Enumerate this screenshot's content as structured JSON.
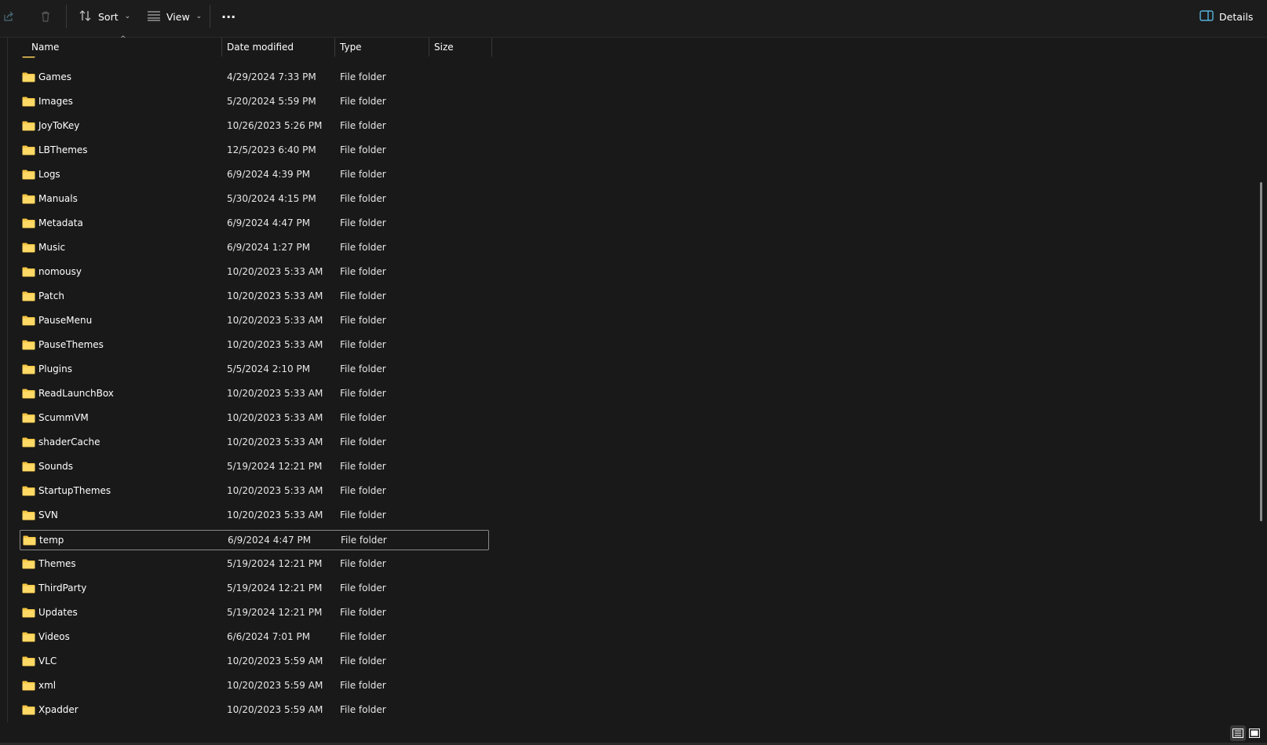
{
  "toolbar": {
    "sort_label": "Sort",
    "view_label": "View",
    "more_label": "···",
    "details_label": "Details"
  },
  "columns": {
    "name": "Name",
    "date": "Date modified",
    "type": "Type",
    "size": "Size"
  },
  "files": [
    {
      "name": "Games",
      "date": "4/29/2024 7:33 PM",
      "type": "File folder"
    },
    {
      "name": "Images",
      "date": "5/20/2024 5:59 PM",
      "type": "File folder"
    },
    {
      "name": "JoyToKey",
      "date": "10/26/2023 5:26 PM",
      "type": "File folder"
    },
    {
      "name": "LBThemes",
      "date": "12/5/2023 6:40 PM",
      "type": "File folder"
    },
    {
      "name": "Logs",
      "date": "6/9/2024 4:39 PM",
      "type": "File folder"
    },
    {
      "name": "Manuals",
      "date": "5/30/2024 4:15 PM",
      "type": "File folder"
    },
    {
      "name": "Metadata",
      "date": "6/9/2024 4:47 PM",
      "type": "File folder"
    },
    {
      "name": "Music",
      "date": "6/9/2024 1:27 PM",
      "type": "File folder"
    },
    {
      "name": "nomousy",
      "date": "10/20/2023 5:33 AM",
      "type": "File folder"
    },
    {
      "name": "Patch",
      "date": "10/20/2023 5:33 AM",
      "type": "File folder"
    },
    {
      "name": "PauseMenu",
      "date": "10/20/2023 5:33 AM",
      "type": "File folder"
    },
    {
      "name": "PauseThemes",
      "date": "10/20/2023 5:33 AM",
      "type": "File folder"
    },
    {
      "name": "Plugins",
      "date": "5/5/2024 2:10 PM",
      "type": "File folder"
    },
    {
      "name": "ReadLaunchBox",
      "date": "10/20/2023 5:33 AM",
      "type": "File folder"
    },
    {
      "name": "ScummVM",
      "date": "10/20/2023 5:33 AM",
      "type": "File folder"
    },
    {
      "name": "shaderCache",
      "date": "10/20/2023 5:33 AM",
      "type": "File folder"
    },
    {
      "name": "Sounds",
      "date": "5/19/2024 12:21 PM",
      "type": "File folder"
    },
    {
      "name": "StartupThemes",
      "date": "10/20/2023 5:33 AM",
      "type": "File folder"
    },
    {
      "name": "SVN",
      "date": "10/20/2023 5:33 AM",
      "type": "File folder"
    },
    {
      "name": "temp",
      "date": "6/9/2024 4:47 PM",
      "type": "File folder",
      "selected": true
    },
    {
      "name": "Themes",
      "date": "5/19/2024 12:21 PM",
      "type": "File folder"
    },
    {
      "name": "ThirdParty",
      "date": "5/19/2024 12:21 PM",
      "type": "File folder"
    },
    {
      "name": "Updates",
      "date": "5/19/2024 12:21 PM",
      "type": "File folder"
    },
    {
      "name": "Videos",
      "date": "6/6/2024 7:01 PM",
      "type": "File folder"
    },
    {
      "name": "VLC",
      "date": "10/20/2023 5:59 AM",
      "type": "File folder"
    },
    {
      "name": "xml",
      "date": "10/20/2023 5:59 AM",
      "type": "File folder"
    },
    {
      "name": "Xpadder",
      "date": "10/20/2023 5:59 AM",
      "type": "File folder"
    }
  ],
  "colors": {
    "background": "#191919",
    "folder": "#f5c542",
    "accent": "#60cdff"
  }
}
